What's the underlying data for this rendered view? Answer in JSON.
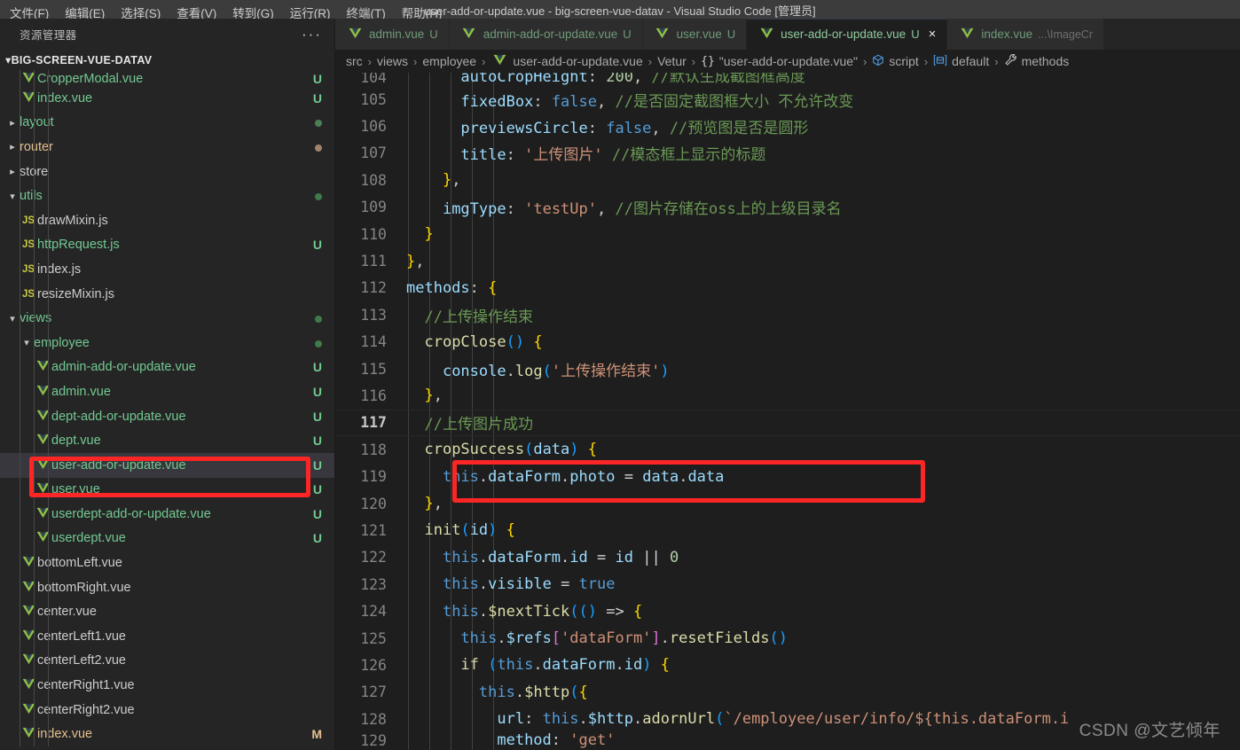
{
  "window": {
    "title": "user-add-or-update.vue - big-screen-vue-datav - Visual Studio Code [管理员]"
  },
  "menu": {
    "items": [
      {
        "label": "文件(F)"
      },
      {
        "label": "编辑(E)"
      },
      {
        "label": "选择(S)"
      },
      {
        "label": "查看(V)"
      },
      {
        "label": "转到(G)"
      },
      {
        "label": "运行(R)"
      },
      {
        "label": "终端(T)"
      },
      {
        "label": "帮助(H)"
      }
    ]
  },
  "sidebar": {
    "header_title": "资源管理器",
    "more_actions": "···",
    "root": "BIG-SCREEN-VUE-DATAV",
    "items": [
      {
        "label": "CropperModal.vue",
        "icon": "vue-icon",
        "kind": "file",
        "indent": 2,
        "badge": "U",
        "badge_color": "#73c991",
        "color": "#73c991",
        "clipped_top": true
      },
      {
        "label": "index.vue",
        "icon": "vue-icon",
        "kind": "file",
        "indent": 2,
        "badge": "U",
        "badge_color": "#73c991",
        "color": "#73c991"
      },
      {
        "label": "layout",
        "icon": "chevron-right-icon",
        "kind": "folder",
        "indent": 1,
        "badge": "dot",
        "badge_color": "#4b7f52",
        "color": "#73c991"
      },
      {
        "label": "router",
        "icon": "chevron-right-icon",
        "kind": "folder",
        "indent": 1,
        "badge": "dot",
        "badge_color": "#a1836a",
        "color": "#e2c08d"
      },
      {
        "label": "store",
        "icon": "chevron-right-icon",
        "kind": "folder",
        "indent": 1,
        "badge": "",
        "badge_color": "",
        "color": "#cccccc"
      },
      {
        "label": "utils",
        "icon": "chevron-down-icon",
        "kind": "folder",
        "indent": 1,
        "badge": "dot",
        "badge_color": "#3f7a4a",
        "color": "#73c991"
      },
      {
        "label": "drawMixin.js",
        "icon": "js-icon",
        "kind": "file",
        "indent": 2,
        "badge": "",
        "badge_color": "",
        "color": "#cccccc"
      },
      {
        "label": "httpRequest.js",
        "icon": "js-icon",
        "kind": "file",
        "indent": 2,
        "badge": "U",
        "badge_color": "#73c991",
        "color": "#73c991"
      },
      {
        "label": "index.js",
        "icon": "js-icon",
        "kind": "file",
        "indent": 2,
        "badge": "",
        "badge_color": "",
        "color": "#cccccc"
      },
      {
        "label": "resizeMixin.js",
        "icon": "js-icon",
        "kind": "file",
        "indent": 2,
        "badge": "",
        "badge_color": "",
        "color": "#cccccc"
      },
      {
        "label": "views",
        "icon": "chevron-down-icon",
        "kind": "folder",
        "indent": 1,
        "badge": "dot",
        "badge_color": "#3f7a4a",
        "color": "#73c991"
      },
      {
        "label": "employee",
        "icon": "chevron-down-icon",
        "kind": "folder",
        "indent": 2,
        "badge": "dot",
        "badge_color": "#3f7a4a",
        "color": "#73c991"
      },
      {
        "label": "admin-add-or-update.vue",
        "icon": "vue-icon",
        "kind": "file",
        "indent": 3,
        "badge": "U",
        "badge_color": "#73c991",
        "color": "#73c991"
      },
      {
        "label": "admin.vue",
        "icon": "vue-icon",
        "kind": "file",
        "indent": 3,
        "badge": "U",
        "badge_color": "#73c991",
        "color": "#73c991"
      },
      {
        "label": "dept-add-or-update.vue",
        "icon": "vue-icon",
        "kind": "file",
        "indent": 3,
        "badge": "U",
        "badge_color": "#73c991",
        "color": "#73c991"
      },
      {
        "label": "dept.vue",
        "icon": "vue-icon",
        "kind": "file",
        "indent": 3,
        "badge": "U",
        "badge_color": "#73c991",
        "color": "#73c991"
      },
      {
        "label": "user-add-or-update.vue",
        "icon": "vue-icon",
        "kind": "file",
        "indent": 3,
        "badge": "U",
        "badge_color": "#73c991",
        "color": "#73c991",
        "selected": true
      },
      {
        "label": "user.vue",
        "icon": "vue-icon",
        "kind": "file",
        "indent": 3,
        "badge": "U",
        "badge_color": "#73c991",
        "color": "#73c991"
      },
      {
        "label": "userdept-add-or-update.vue",
        "icon": "vue-icon",
        "kind": "file",
        "indent": 3,
        "badge": "U",
        "badge_color": "#73c991",
        "color": "#73c991"
      },
      {
        "label": "userdept.vue",
        "icon": "vue-icon",
        "kind": "file",
        "indent": 3,
        "badge": "U",
        "badge_color": "#73c991",
        "color": "#73c991"
      },
      {
        "label": "bottomLeft.vue",
        "icon": "vue-icon",
        "kind": "file",
        "indent": 2,
        "badge": "",
        "badge_color": "",
        "color": "#cccccc"
      },
      {
        "label": "bottomRight.vue",
        "icon": "vue-icon",
        "kind": "file",
        "indent": 2,
        "badge": "",
        "badge_color": "",
        "color": "#cccccc"
      },
      {
        "label": "center.vue",
        "icon": "vue-icon",
        "kind": "file",
        "indent": 2,
        "badge": "",
        "badge_color": "",
        "color": "#cccccc"
      },
      {
        "label": "centerLeft1.vue",
        "icon": "vue-icon",
        "kind": "file",
        "indent": 2,
        "badge": "",
        "badge_color": "",
        "color": "#cccccc"
      },
      {
        "label": "centerLeft2.vue",
        "icon": "vue-icon",
        "kind": "file",
        "indent": 2,
        "badge": "",
        "badge_color": "",
        "color": "#cccccc"
      },
      {
        "label": "centerRight1.vue",
        "icon": "vue-icon",
        "kind": "file",
        "indent": 2,
        "badge": "",
        "badge_color": "",
        "color": "#cccccc"
      },
      {
        "label": "centerRight2.vue",
        "icon": "vue-icon",
        "kind": "file",
        "indent": 2,
        "badge": "",
        "badge_color": "",
        "color": "#cccccc"
      },
      {
        "label": "index.vue",
        "icon": "vue-icon",
        "kind": "file",
        "indent": 2,
        "badge": "M",
        "badge_color": "#e2c08d",
        "color": "#e2c08d"
      }
    ]
  },
  "tabs": [
    {
      "name": "admin.vue",
      "status": "U",
      "active": false,
      "dim": "",
      "closable": false
    },
    {
      "name": "admin-add-or-update.vue",
      "status": "U",
      "active": false,
      "dim": "",
      "closable": false
    },
    {
      "name": "user.vue",
      "status": "U",
      "active": false,
      "dim": "",
      "closable": false
    },
    {
      "name": "user-add-or-update.vue",
      "status": "U",
      "active": true,
      "dim": "",
      "closable": true,
      "close_label": "×"
    },
    {
      "name": "index.vue",
      "status": "",
      "active": false,
      "dim": "...\\ImageCr",
      "closable": false
    }
  ],
  "breadcrumb": {
    "items": [
      {
        "label": "src",
        "icon": ""
      },
      {
        "label": "views",
        "icon": ""
      },
      {
        "label": "employee",
        "icon": ""
      },
      {
        "label": "user-add-or-update.vue",
        "icon": "vue-icon"
      },
      {
        "label": "Vetur",
        "icon": ""
      },
      {
        "label": "\"user-add-or-update.vue\"",
        "icon": "braces-icon"
      },
      {
        "label": "script",
        "icon": "cube-icon"
      },
      {
        "label": "default",
        "icon": "module-icon"
      },
      {
        "label": "methods",
        "icon": "wrench-icon"
      }
    ],
    "separator": "›"
  },
  "editor": {
    "language": "vue",
    "first_visible_line": 104,
    "current_line": 117,
    "lines": [
      {
        "no": 104,
        "clipped": true
      },
      {
        "no": 105
      },
      {
        "no": 106
      },
      {
        "no": 107
      },
      {
        "no": 108
      },
      {
        "no": 109
      },
      {
        "no": 110
      },
      {
        "no": 111
      },
      {
        "no": 112
      },
      {
        "no": 113
      },
      {
        "no": 114
      },
      {
        "no": 115
      },
      {
        "no": 116
      },
      {
        "no": 117,
        "current": true
      },
      {
        "no": 118
      },
      {
        "no": 119
      },
      {
        "no": 120
      },
      {
        "no": 121
      },
      {
        "no": 122
      },
      {
        "no": 123
      },
      {
        "no": 124
      },
      {
        "no": 125
      },
      {
        "no": 126
      },
      {
        "no": 127
      },
      {
        "no": 128
      },
      {
        "no": 129,
        "clipped": true
      }
    ],
    "code": {
      "l104": {
        "text": "autoCropHeight: 200, //默认生成截图框高度"
      },
      "l105": {
        "text": "fixedBox: false, //是否固定截图框大小 不允许改变"
      },
      "l106": {
        "text": "previewsCircle: false, //预览图是否是圆形"
      },
      "l107": {
        "text": "title: '上传图片' //模态框上显示的标题"
      },
      "l108": {
        "text": "},"
      },
      "l109": {
        "text": "imgType: 'testUp', //图片存储在oss上的上级目录名"
      },
      "l110": {
        "text": "}"
      },
      "l111": {
        "text": "},"
      },
      "l112": {
        "text": "methods: {"
      },
      "l113": {
        "text": "//上传操作结束"
      },
      "l114": {
        "text": "cropClose() {"
      },
      "l115": {
        "text": "console.log('上传操作结束')"
      },
      "l116": {
        "text": "},"
      },
      "l117": {
        "text": "//上传图片成功"
      },
      "l118": {
        "text": "cropSuccess(data) {"
      },
      "l119": {
        "text": "this.dataForm.photo = data.data"
      },
      "l120": {
        "text": "},"
      },
      "l121": {
        "text": "init(id) {"
      },
      "l122": {
        "text": "this.dataForm.id = id || 0"
      },
      "l123": {
        "text": "this.visible = true"
      },
      "l124": {
        "text": "this.$nextTick(() => {"
      },
      "l125": {
        "text": "this.$refs['dataForm'].resetFields()"
      },
      "l126": {
        "text": "if (this.dataForm.id) {"
      },
      "l127": {
        "text": "this.$http({"
      },
      "l128": {
        "text": "url: this.$http.adornUrl(`/employee/user/info/${this.dataForm.i"
      },
      "l129": {
        "text": "method: 'get'"
      }
    }
  },
  "annotations": [
    {
      "name": "sidebar-highlight-box",
      "color": "#fc2626"
    },
    {
      "name": "code-highlight-box",
      "color": "#fc2626"
    }
  ],
  "watermark": {
    "text": "CSDN @文艺倾年"
  }
}
